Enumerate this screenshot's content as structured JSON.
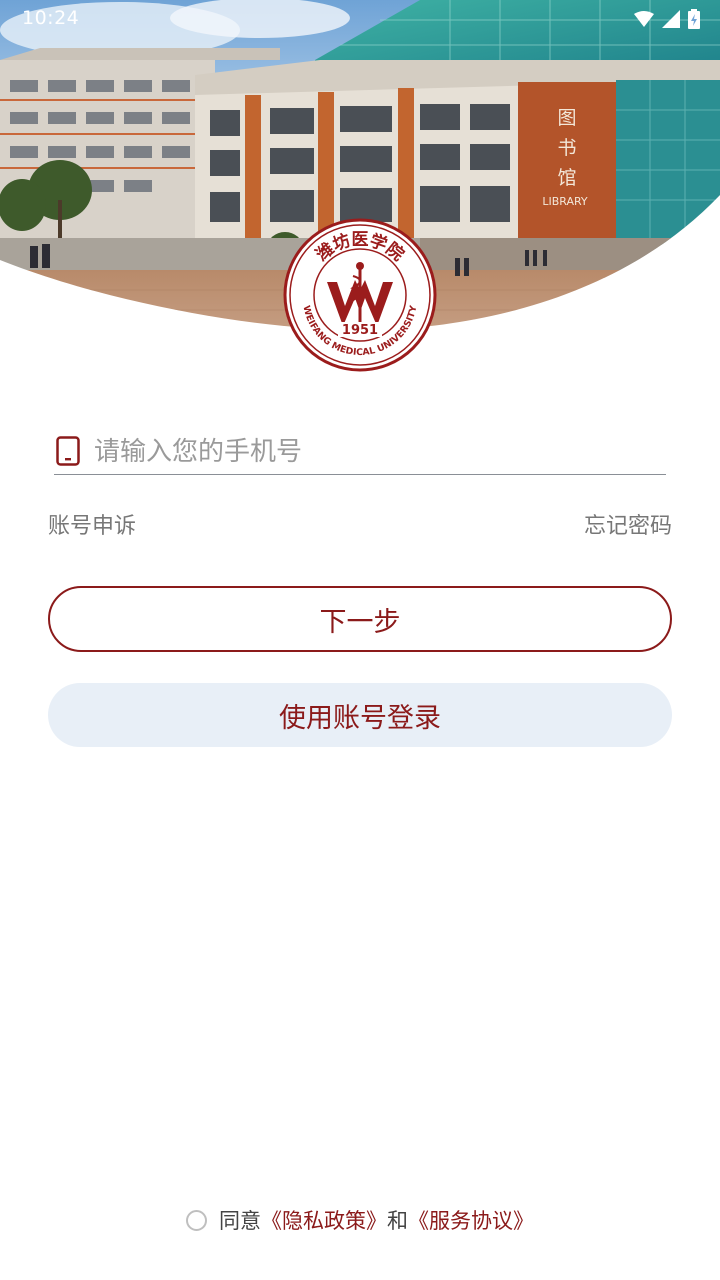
{
  "status_bar": {
    "time": "10:24",
    "icons": [
      "wifi-icon",
      "signal-icon",
      "battery-icon"
    ]
  },
  "hero": {
    "building_sign": "图书馆",
    "building_sign_en": "LIBRARY"
  },
  "logo": {
    "name_cn": "潍坊医学院",
    "name_en": "WEIFANG MEDICAL UNIVERSITY",
    "year": "1951",
    "color": "#9b1c1c"
  },
  "login": {
    "phone_placeholder": "请输入您的手机号",
    "phone_value": "",
    "appeal_link": "账号申诉",
    "forgot_link": "忘记密码",
    "next_button": "下一步",
    "account_login_button": "使用账号登录"
  },
  "agreement": {
    "prefix": "同意",
    "privacy_link": "《隐私政策》",
    "conjunction": "和",
    "service_link": "《服务协议》",
    "checked": false
  },
  "colors": {
    "accent": "#8b1a1a",
    "secondary_button_bg": "#e8eff7",
    "link_gray": "#777777"
  }
}
